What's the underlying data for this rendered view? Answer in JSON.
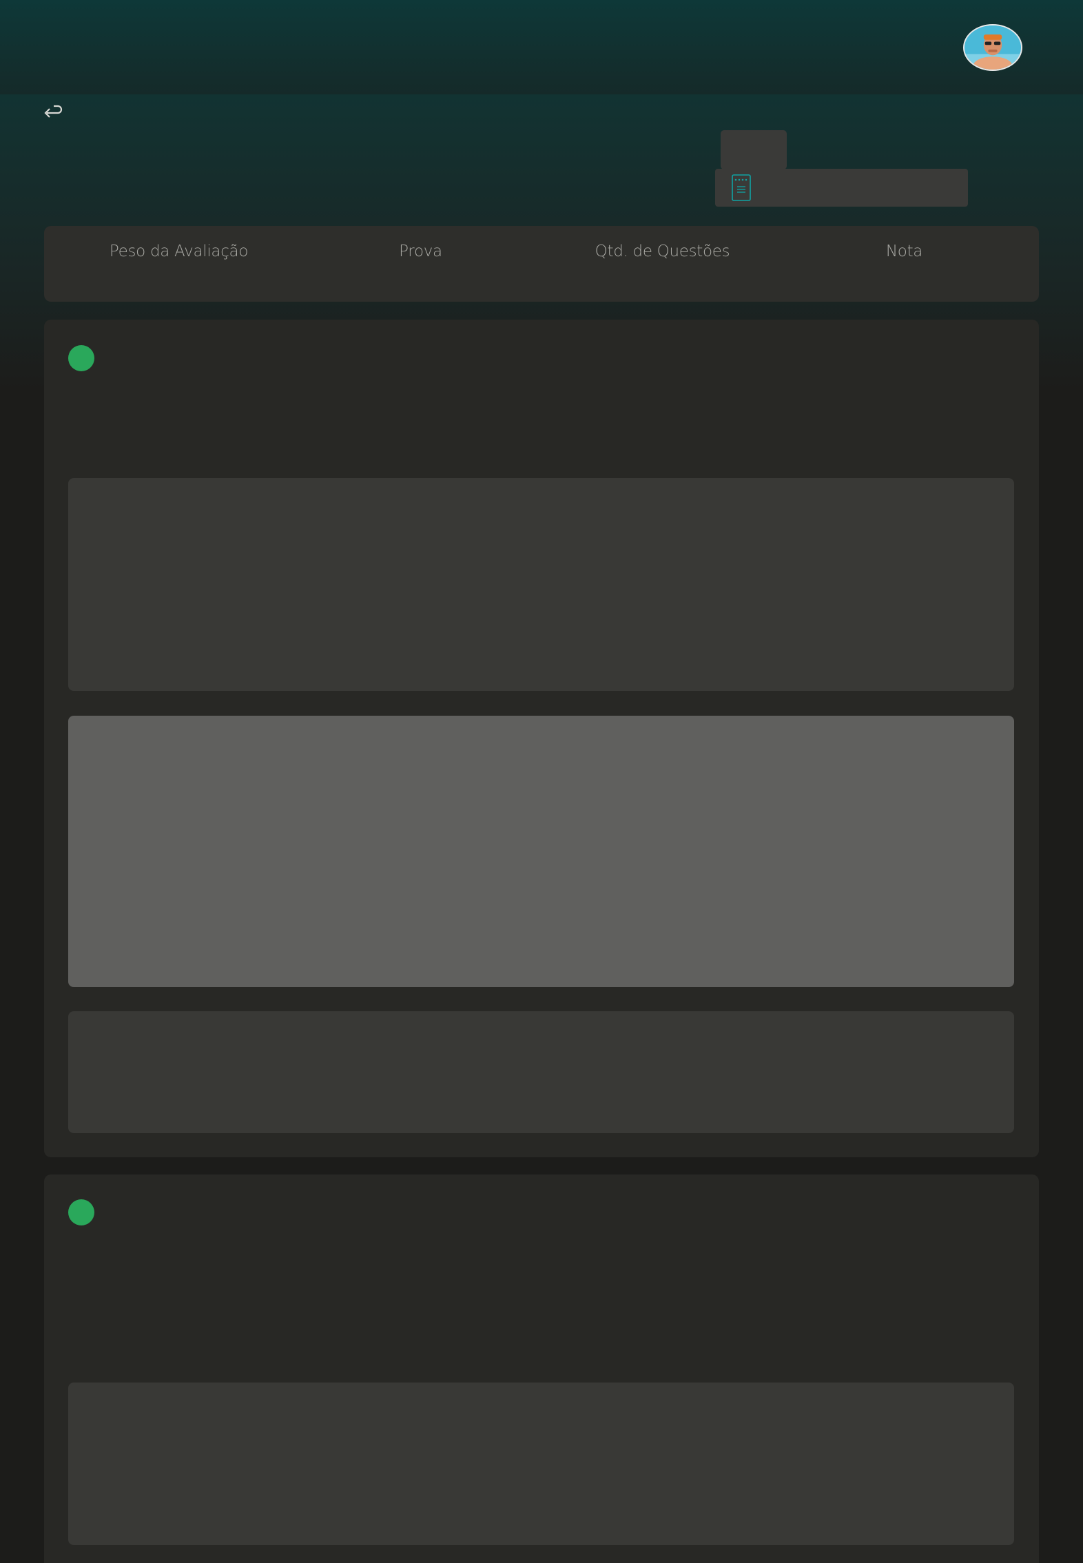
{
  "header": {
    "avatar_icon": "user-avatar-photo",
    "back_icon": "return-arrow-icon",
    "file_icon": "document-icon"
  },
  "summary_table": {
    "columns": [
      "Peso da Avaliação",
      "Prova",
      "Qtd. de Questões",
      "Nota"
    ]
  },
  "questions": [
    {
      "status_color": "#2aa85b",
      "options_count_visible": 3,
      "selected_index": 1
    },
    {
      "status_color": "#2aa85b",
      "options_count_visible": 1,
      "selected_index": null
    }
  ],
  "colors": {
    "accent_teal": "#0fa3a3",
    "status_green": "#2aa85b",
    "card_bg": "#282825",
    "option_bg": "#393936",
    "option_selected_bg": "#60605e"
  }
}
